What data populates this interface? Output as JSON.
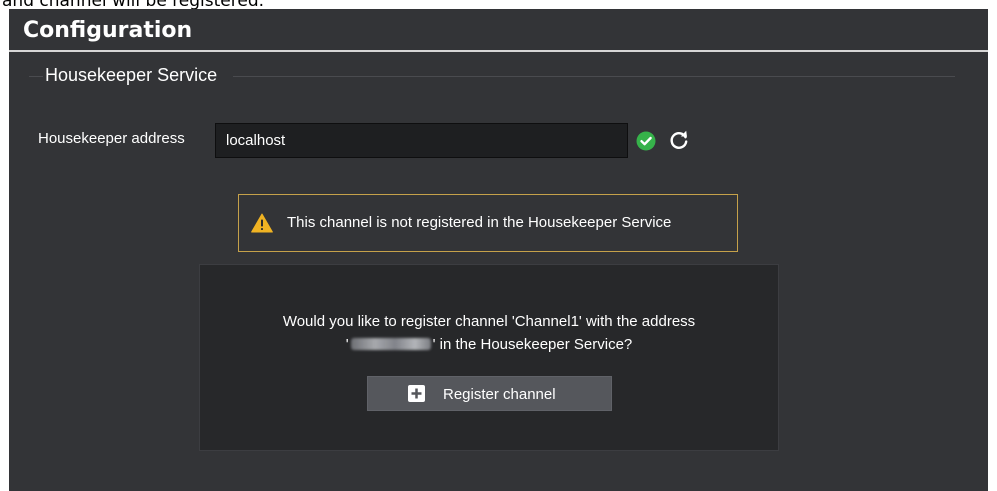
{
  "page": {
    "top_text": "and channel will be registered."
  },
  "panel": {
    "title": "Configuration"
  },
  "housekeeper": {
    "legend": "Housekeeper Service",
    "address_label": "Housekeeper address",
    "address_value": "localhost",
    "status_icon": "check-circle-icon",
    "refresh_icon": "refresh-icon"
  },
  "warning": {
    "icon": "warning-triangle-icon",
    "text": "This channel is not registered in the Housekeeper Service"
  },
  "registration": {
    "question_line1": "Would you like to register channel 'Channel1' with the address",
    "question_prefix": "'",
    "question_suffix": "' in the Housekeeper Service?",
    "button_icon": "plus-square-icon",
    "button_label": "Register channel"
  },
  "colors": {
    "panel_background": "#333437",
    "card_background": "#27282a",
    "success_green": "#36b24a",
    "warning_border": "#c5a14a",
    "warning_yellow": "#f0b323",
    "button_background": "#55575c"
  }
}
